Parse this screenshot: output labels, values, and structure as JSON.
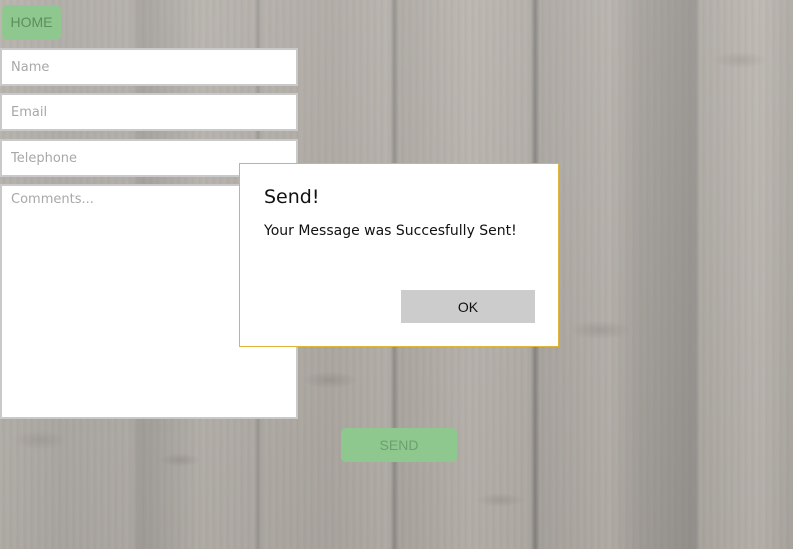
{
  "nav": {
    "home_label": "HOME"
  },
  "form": {
    "name_placeholder": "Name",
    "email_placeholder": "Email",
    "telephone_placeholder": "Telephone",
    "comments_placeholder": "Comments...",
    "send_label": "SEND"
  },
  "dialog": {
    "title": "Send!",
    "message": "Your Message was Succesfully Sent!",
    "ok_label": "OK"
  },
  "colors": {
    "button_green": "#8fc88f",
    "dialog_border": "#e0b53a",
    "ok_button_gray": "#cccccc"
  }
}
